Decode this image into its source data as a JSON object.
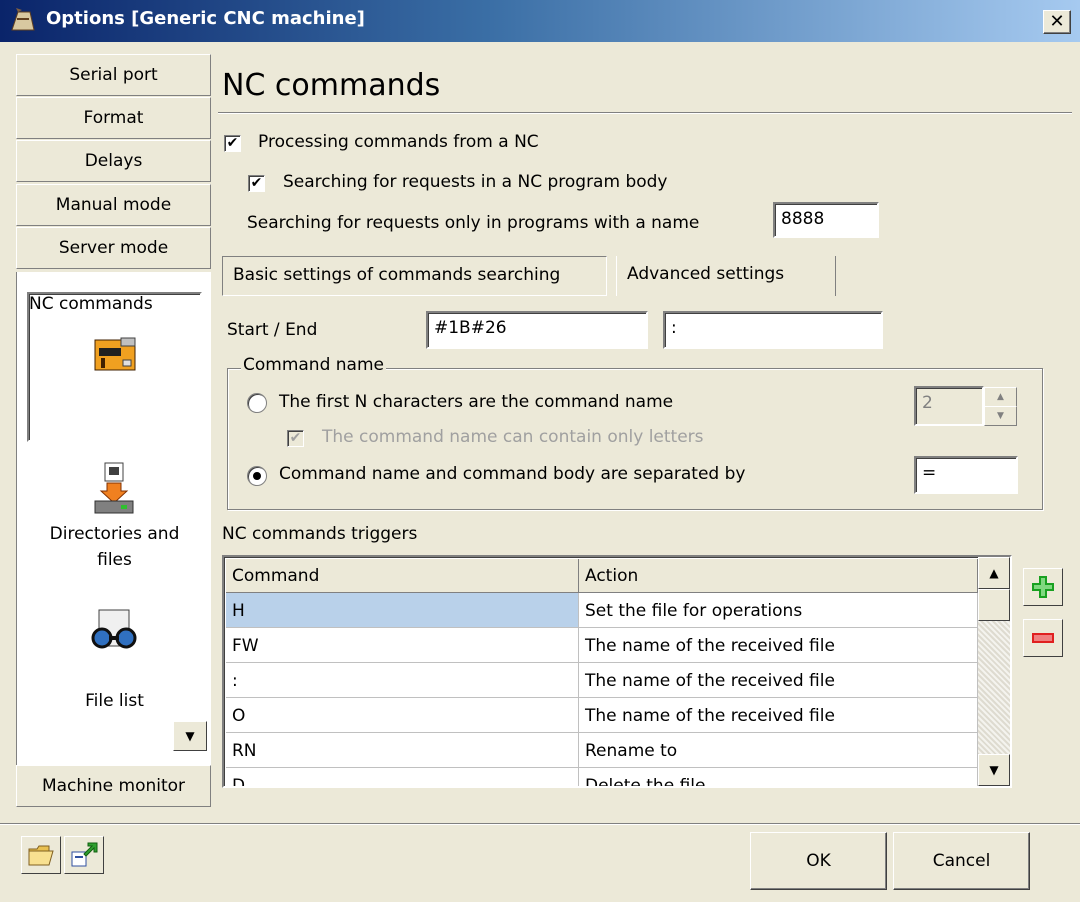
{
  "window": {
    "title": "Options [Generic CNC machine]",
    "close_glyph": "✕"
  },
  "nav": {
    "top_buttons": [
      "Serial port",
      "Format",
      "Delays",
      "Manual mode",
      "Server mode"
    ],
    "items": [
      {
        "label": "NC commands",
        "icon": "nc-commands-icon"
      },
      {
        "label_line1": "Directories and",
        "label_line2": "files",
        "icon": "directories-icon"
      },
      {
        "label": "File list",
        "icon": "file-list-icon"
      }
    ],
    "bottom_button": "Machine monitor"
  },
  "page": {
    "heading": "NC commands"
  },
  "options": {
    "processing_label": "Processing commands from a NC",
    "processing_checked": true,
    "searching_body_label": "Searching for requests in a NC program body",
    "searching_body_checked": true,
    "name_filter_label": "Searching for requests only in programs with a name",
    "name_filter_value": "8888"
  },
  "tabs": [
    {
      "label": "Basic settings of commands searching",
      "active": true
    },
    {
      "label": "Advanced settings",
      "active": false
    }
  ],
  "start_end": {
    "label": "Start / End",
    "start_value": "#1B#26",
    "end_value": ":"
  },
  "command_name": {
    "legend": "Command name",
    "option1_label": "The first N characters are the command name",
    "option1_value": "2",
    "letters_only_label": "The command name can contain only letters",
    "option2_label": "Command name and command body are separated by",
    "option2_value": "="
  },
  "triggers": {
    "label": "NC commands triggers",
    "columns": [
      "Command",
      "Action"
    ],
    "rows": [
      [
        "H",
        "Set the file for operations"
      ],
      [
        "FW",
        "The name of the received file"
      ],
      [
        ":",
        "The name of the received file"
      ],
      [
        "O",
        "The name of the received file"
      ],
      [
        "RN",
        "Rename to"
      ],
      [
        "D",
        "Delete the file"
      ]
    ]
  },
  "buttons": {
    "ok": "OK",
    "cancel": "Cancel"
  },
  "colors": {
    "selected_row": "#b9d1ea",
    "titlebar": "#0a246a",
    "add": "#18a020",
    "remove": "#e02020"
  }
}
